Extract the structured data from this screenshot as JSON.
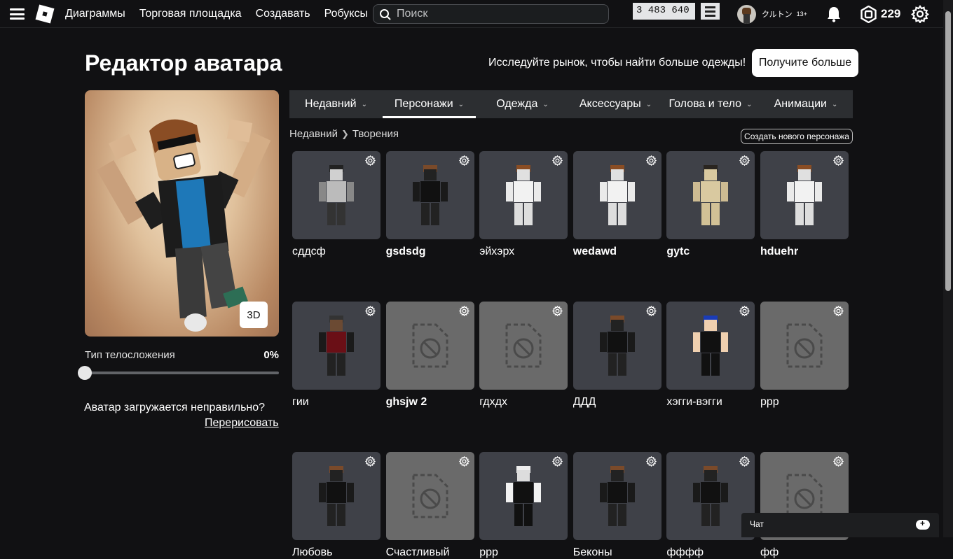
{
  "nav": {
    "items": [
      "Диаграммы",
      "Торговая площадка",
      "Создавать",
      "Робуксы"
    ],
    "search_placeholder": "Поиск",
    "counter": "3 483 640",
    "username": "クルトン",
    "age_badge": "13+",
    "robux": "229"
  },
  "page": {
    "title": "Редактор аватара",
    "promo_text": "Исследуйте рынок, чтобы найти больше одежды!",
    "get_more_label": "Получите больше"
  },
  "preview": {
    "btn_3d": "3D",
    "body_type_label": "Тип телосложения",
    "body_type_value": "0%",
    "body_type_level": 0,
    "load_issue_text": "Аватар загружается неправильно?",
    "redraw_label": "Перерисовать"
  },
  "tabs": [
    {
      "label": "Недавний",
      "active": false
    },
    {
      "label": "Персонажи",
      "active": true
    },
    {
      "label": "Одежда",
      "active": false
    },
    {
      "label": "Аксессуары",
      "active": false
    },
    {
      "label": "Голова и тело",
      "active": false
    },
    {
      "label": "Анимации",
      "active": false
    }
  ],
  "breadcrumb": {
    "parent": "Недавний",
    "current": "Творения"
  },
  "create_new_label": "Создать нового персонажа",
  "characters": [
    {
      "name": "сддсф",
      "bold": false,
      "empty": false,
      "style": "grey"
    },
    {
      "name": "gsdsdg",
      "bold": true,
      "empty": false,
      "style": "black"
    },
    {
      "name": "эйхэрх",
      "bold": false,
      "empty": false,
      "style": "white"
    },
    {
      "name": "wedawd",
      "bold": true,
      "empty": false,
      "style": "white"
    },
    {
      "name": "gytc",
      "bold": true,
      "empty": false,
      "style": "bare"
    },
    {
      "name": "hduehr",
      "bold": true,
      "empty": false,
      "style": "white"
    },
    {
      "name": "гии",
      "bold": false,
      "empty": false,
      "style": "red"
    },
    {
      "name": "ghsjw 2",
      "bold": true,
      "empty": true,
      "style": "none"
    },
    {
      "name": "гдхдх",
      "bold": false,
      "empty": true,
      "style": "none"
    },
    {
      "name": "ДДД",
      "bold": false,
      "empty": false,
      "style": "black"
    },
    {
      "name": "хэгги-вэгги",
      "bold": false,
      "empty": false,
      "style": "blue"
    },
    {
      "name": "ppp",
      "bold": false,
      "empty": true,
      "style": "none"
    },
    {
      "name": "Любовь",
      "bold": false,
      "empty": false,
      "style": "black"
    },
    {
      "name": "Счастливый",
      "bold": false,
      "empty": true,
      "style": "none"
    },
    {
      "name": "ppp",
      "bold": false,
      "empty": false,
      "style": "whitehead"
    },
    {
      "name": "Беконы",
      "bold": false,
      "empty": false,
      "style": "black"
    },
    {
      "name": "фффф",
      "bold": false,
      "empty": false,
      "style": "black"
    },
    {
      "name": "фф",
      "bold": false,
      "empty": true,
      "style": "none"
    }
  ],
  "chat": {
    "label": "Чат"
  }
}
